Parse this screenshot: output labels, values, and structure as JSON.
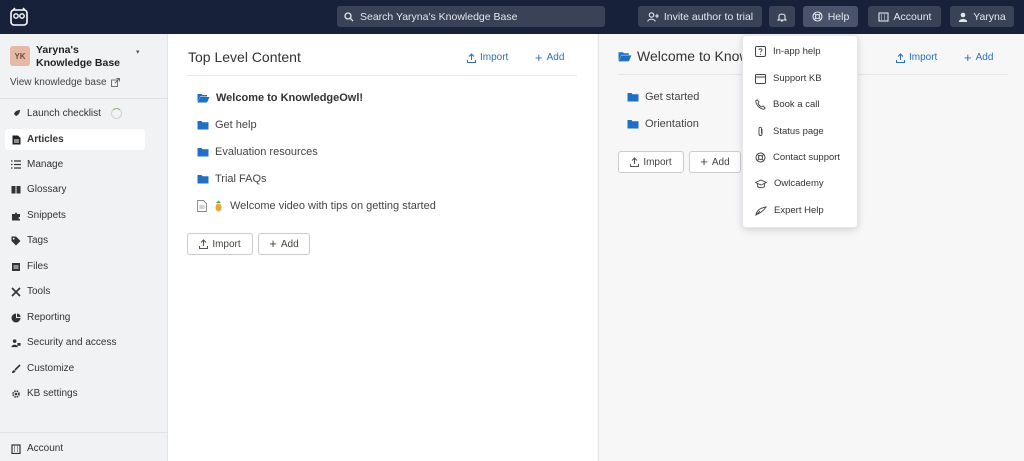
{
  "topbar": {
    "search_placeholder": "Search Yaryna's Knowledge Base",
    "invite_label": "Invite author to trial",
    "help_label": "Help",
    "account_label": "Account",
    "user_label": "Yaryna"
  },
  "sidebar": {
    "kb_initials": "YK",
    "kb_name": "Yaryna's Knowledge Base",
    "view_kb": "View knowledge base",
    "items": [
      {
        "label": "Launch checklist",
        "icon": "rocket-icon"
      },
      {
        "label": "Articles",
        "icon": "article-icon"
      },
      {
        "label": "Manage",
        "icon": "list-icon"
      },
      {
        "label": "Glossary",
        "icon": "book-icon"
      },
      {
        "label": "Snippets",
        "icon": "puzzle-icon"
      },
      {
        "label": "Tags",
        "icon": "tag-icon"
      },
      {
        "label": "Files",
        "icon": "files-icon"
      },
      {
        "label": "Tools",
        "icon": "tools-icon"
      },
      {
        "label": "Reporting",
        "icon": "chart-pie-icon"
      },
      {
        "label": "Security and access",
        "icon": "users-lock-icon"
      },
      {
        "label": "Customize",
        "icon": "brush-icon"
      },
      {
        "label": "KB settings",
        "icon": "gear-icon"
      }
    ],
    "bottom_account": "Account"
  },
  "panel1": {
    "title": "Top Level Content",
    "import_label": "Import",
    "add_label": "Add",
    "items": [
      {
        "label": "Welcome to KnowledgeOwl!",
        "type": "folder-open"
      },
      {
        "label": "Get help",
        "type": "folder"
      },
      {
        "label": "Evaluation resources",
        "type": "folder"
      },
      {
        "label": "Trial FAQs",
        "type": "folder"
      },
      {
        "label": "Welcome video with tips on getting started",
        "type": "article"
      }
    ],
    "btn_import": "Import",
    "btn_add": "Add"
  },
  "panel2": {
    "title": "Welcome to Knowle",
    "import_label": "Import",
    "add_label": "Add",
    "items": [
      {
        "label": "Get started"
      },
      {
        "label": "Orientation"
      }
    ],
    "btn_import": "Import",
    "btn_add": "Add"
  },
  "help_menu": [
    {
      "label": "In-app help",
      "icon": "question-square-icon"
    },
    {
      "label": "Support KB",
      "icon": "window-icon"
    },
    {
      "label": "Book a call",
      "icon": "phone-icon"
    },
    {
      "label": "Status page",
      "icon": "paperclip-icon"
    },
    {
      "label": "Contact support",
      "icon": "lifebuoy-icon"
    },
    {
      "label": "Owlcademy",
      "icon": "graduation-cap-icon"
    },
    {
      "label": "Expert Help",
      "icon": "expert-icon"
    }
  ],
  "colors": {
    "topbar": "#17213a",
    "accent": "#2e6fb7",
    "folder": "#1f6fc4"
  }
}
